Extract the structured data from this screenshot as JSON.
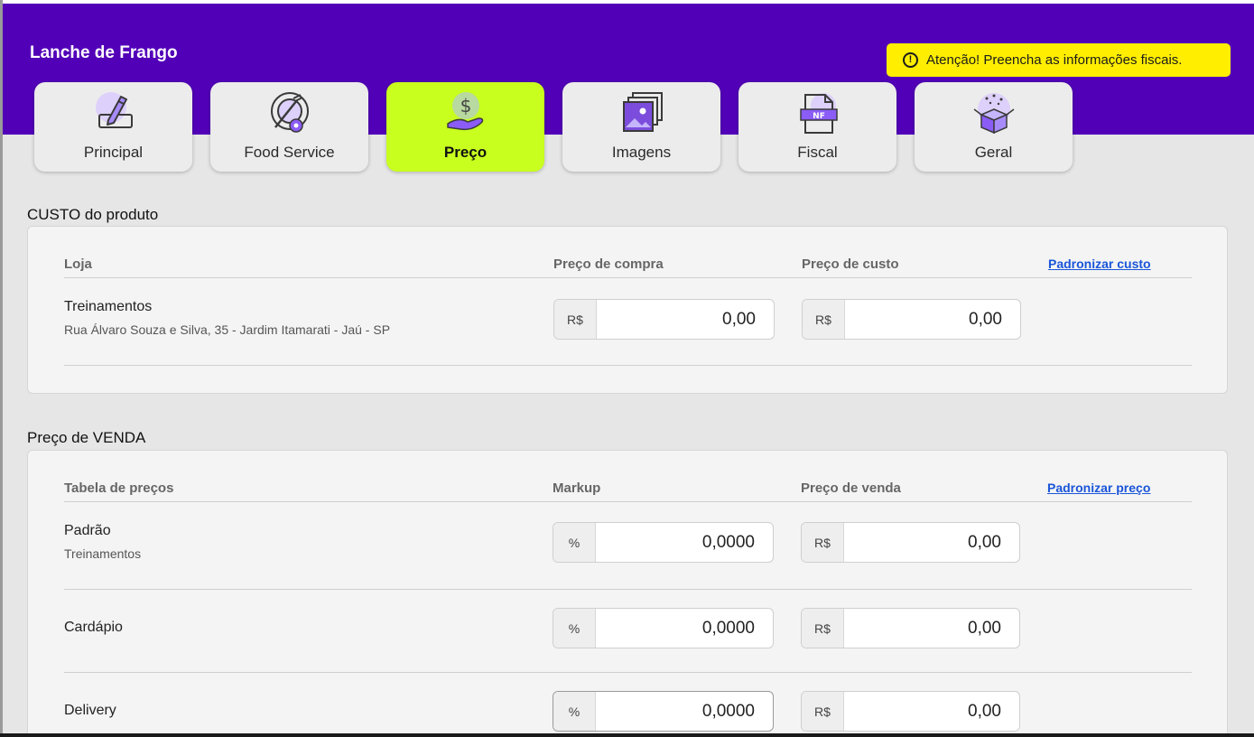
{
  "product": {
    "title": "Lanche de Frango"
  },
  "alert": {
    "text": "Atenção! Preencha as informações fiscais."
  },
  "tabs": [
    {
      "label": "Principal",
      "icon": "pencil-icon",
      "active": false
    },
    {
      "label": "Food Service",
      "icon": "plate-icon",
      "active": false
    },
    {
      "label": "Preço",
      "icon": "money-hand-icon",
      "active": true
    },
    {
      "label": "Imagens",
      "icon": "images-icon",
      "active": false
    },
    {
      "label": "Fiscal",
      "icon": "invoice-icon",
      "active": false
    },
    {
      "label": "Geral",
      "icon": "box-icon",
      "active": false
    }
  ],
  "custo": {
    "title": "CUSTO do produto",
    "headers": {
      "store": "Loja",
      "purchase": "Preço de compra",
      "cost": "Preço de custo"
    },
    "link": "Padronizar custo",
    "rows": [
      {
        "name": "Treinamentos",
        "address": "Rua Álvaro Souza e Silva, 35 - Jardim Itamarati - Jaú - SP",
        "purchase_prefix": "R$",
        "purchase_value": "0,00",
        "cost_prefix": "R$",
        "cost_value": "0,00"
      }
    ]
  },
  "venda": {
    "title": "Preço de VENDA",
    "headers": {
      "table": "Tabela de preços",
      "markup": "Markup",
      "price": "Preço de venda"
    },
    "link": "Padronizar preço",
    "rows": [
      {
        "name": "Padrão",
        "sub": "Treinamentos",
        "markup_prefix": "%",
        "markup_value": "0,0000",
        "price_prefix": "R$",
        "price_value": "0,00"
      },
      {
        "name": "Cardápio",
        "sub": "",
        "markup_prefix": "%",
        "markup_value": "0,0000",
        "price_prefix": "R$",
        "price_value": "0,00"
      },
      {
        "name": "Delivery",
        "sub": "",
        "markup_prefix": "%",
        "markup_value": "0,0000",
        "price_prefix": "R$",
        "price_value": "0,00"
      }
    ]
  },
  "colors": {
    "header": "#5200b8",
    "active_tab": "#c8ff1e",
    "alert": "#ffee00",
    "link": "#1a55d8",
    "icon_purple": "#8b5cf6"
  }
}
